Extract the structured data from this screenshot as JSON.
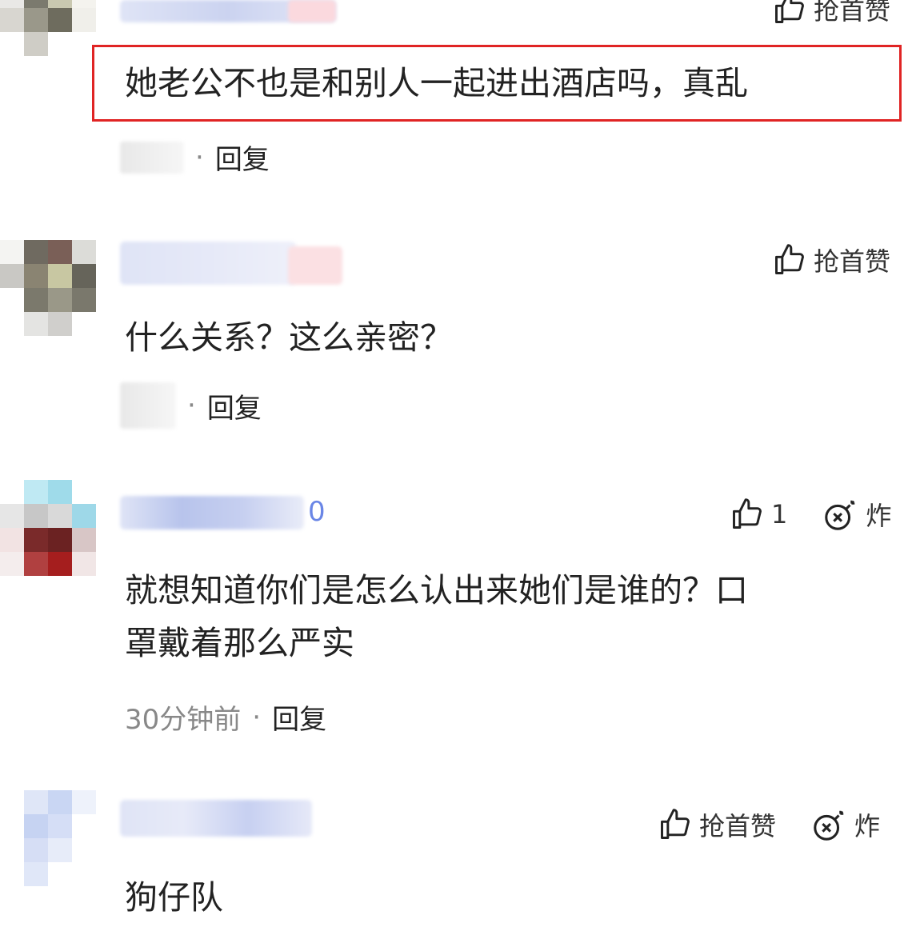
{
  "colors": {
    "highlight": "#e02424",
    "accent": "#6a86e6",
    "meta_gray": "#888888"
  },
  "comments": [
    {
      "text": "她老公不也是和别人一起进出酒店吗，真乱",
      "action_label": "抢首赞",
      "reply": "回复",
      "time": "",
      "highlighted": true
    },
    {
      "text": "什么关系？这么亲密？",
      "action_label": "抢首赞",
      "reply": "回复",
      "time": ""
    },
    {
      "text_line1": "就想知道你们是怎么认出来她们是谁的？口",
      "text_line2": "罩戴着那么严实",
      "like_count": "1",
      "bomb_label": "炸",
      "name_tail": "0",
      "time": "30分钟前",
      "reply": "回复"
    },
    {
      "text": "狗仔队",
      "action_label": "抢首赞",
      "bomb_label": "炸"
    }
  ],
  "separator": "·",
  "icons": [
    "thumbs-up-icon",
    "bomb-icon"
  ]
}
